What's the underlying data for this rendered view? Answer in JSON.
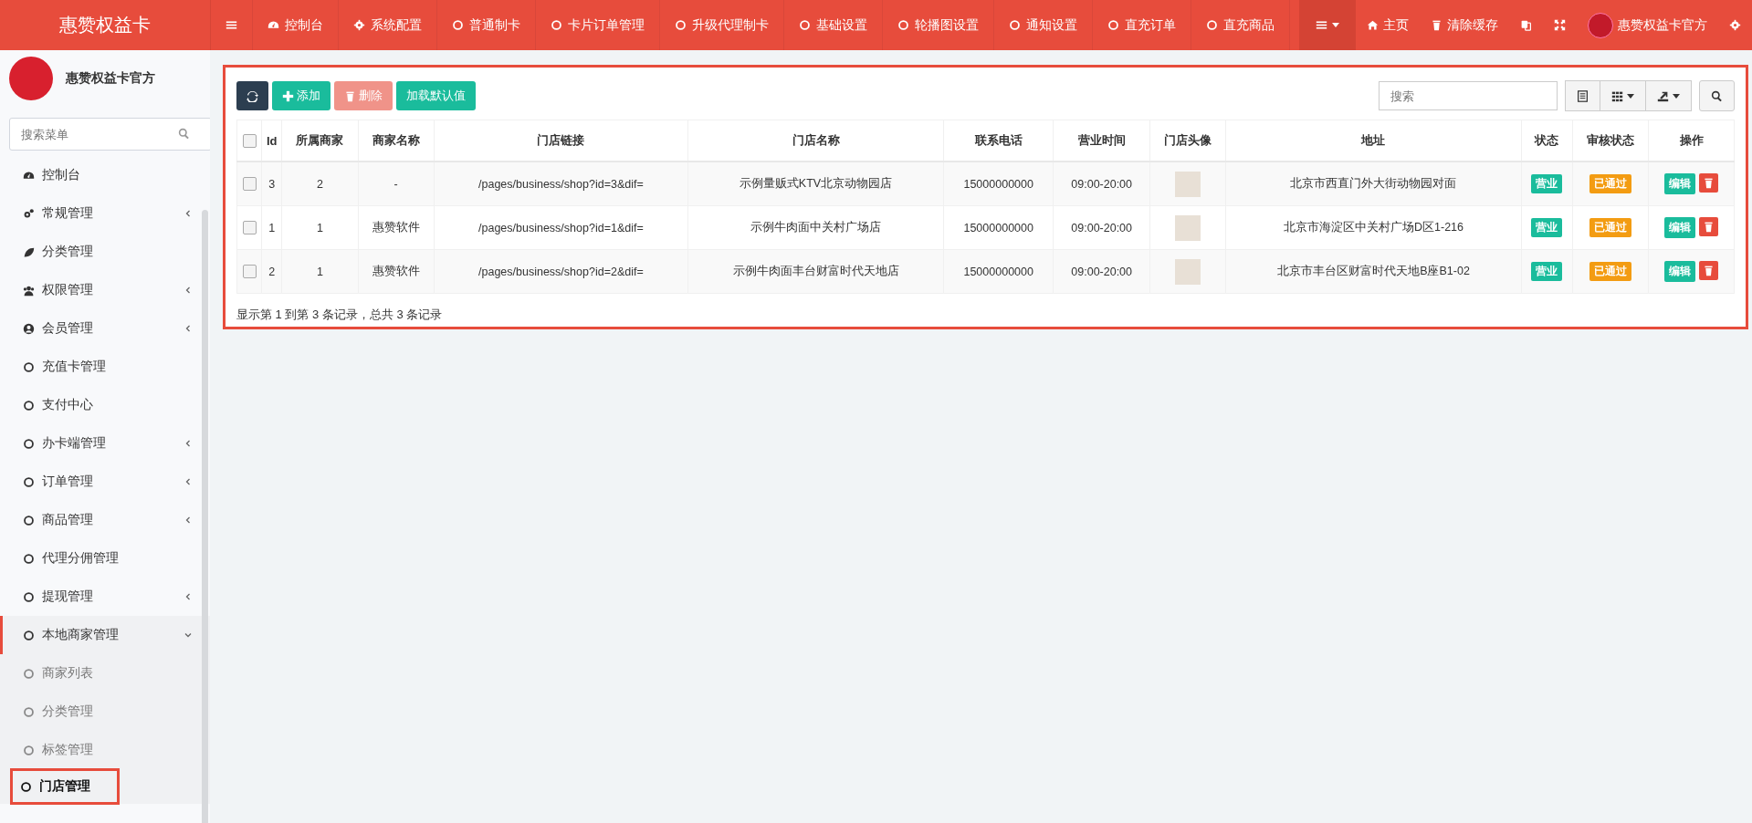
{
  "brand": {
    "title": "惠赞权益卡"
  },
  "top_nav": [
    {
      "label": "控制台",
      "kind": "dashboard"
    },
    {
      "label": "系统配置",
      "kind": "gear"
    },
    {
      "label": "普通制卡",
      "kind": "circle"
    },
    {
      "label": "卡片订单管理",
      "kind": "circle"
    },
    {
      "label": "升级代理制卡",
      "kind": "circle"
    },
    {
      "label": "基础设置",
      "kind": "circle"
    },
    {
      "label": "轮播图设置",
      "kind": "circle"
    },
    {
      "label": "通知设置",
      "kind": "circle"
    },
    {
      "label": "直充订单",
      "kind": "circle"
    },
    {
      "label": "直充商品",
      "kind": "circle"
    }
  ],
  "top_right": [
    {
      "kind": "menu"
    },
    {
      "kind": "home",
      "label": "主页"
    },
    {
      "kind": "trash",
      "label": "清除缓存"
    },
    {
      "kind": "translate"
    },
    {
      "kind": "fullscreen"
    },
    {
      "kind": "user",
      "label": "惠赞权益卡官方"
    },
    {
      "kind": "settings"
    }
  ],
  "sidebar": {
    "user": {
      "name": "惠赞权益卡官方"
    },
    "search": {
      "placeholder": "搜索菜单"
    },
    "items": [
      {
        "label": "控制台",
        "kind": "dashboard"
      },
      {
        "label": "常规管理",
        "kind": "cogs",
        "expanded": false
      },
      {
        "label": "分类管理",
        "kind": "leaf"
      },
      {
        "label": "权限管理",
        "kind": "users",
        "expanded": false
      },
      {
        "label": "会员管理",
        "kind": "user",
        "expanded": false
      },
      {
        "label": "充值卡管理",
        "kind": "circle"
      },
      {
        "label": "支付中心",
        "kind": "circle"
      },
      {
        "label": "办卡端管理",
        "kind": "circle",
        "expanded": false
      },
      {
        "label": "订单管理",
        "kind": "circle",
        "expanded": false
      },
      {
        "label": "商品管理",
        "kind": "circle",
        "expanded": false
      },
      {
        "label": "代理分佣管理",
        "kind": "circle"
      },
      {
        "label": "提现管理",
        "kind": "circle",
        "expanded": false
      },
      {
        "label": "本地商家管理",
        "kind": "circle",
        "expanded": true,
        "children": [
          {
            "label": "商家列表",
            "selected": false
          },
          {
            "label": "分类管理",
            "selected": false
          },
          {
            "label": "标签管理",
            "selected": false
          },
          {
            "label": "门店管理",
            "selected": true
          }
        ]
      }
    ]
  },
  "toolbar": {
    "buttons": [
      {
        "kind": "refresh"
      },
      {
        "kind": "add",
        "label": "添加"
      },
      {
        "kind": "delete",
        "label": "删除",
        "disabled": true
      },
      {
        "kind": "load",
        "label": "加载默认值"
      }
    ],
    "search": {
      "placeholder": "搜索"
    }
  },
  "table": {
    "all_checked": false,
    "columns": [
      "Id",
      "所属商家",
      "商家名称",
      "门店链接",
      "门店名称",
      "联系电话",
      "营业时间",
      "门店头像",
      "地址",
      "状态",
      "审核状态",
      "操作"
    ],
    "rows": [
      {
        "checked": false,
        "id": "3",
        "merchant_id": "2",
        "merchant_name": "-",
        "link": "/pages/business/shop?id=3&dif=",
        "name": "示例量贩式KTV北京动物园店",
        "phone": "15000000000",
        "hours": "09:00-20:00",
        "address": "北京市西直门外大街动物园对面",
        "status": "营业",
        "review": "已通过",
        "edit": "编辑"
      },
      {
        "checked": false,
        "id": "1",
        "merchant_id": "1",
        "merchant_name": "惠赞软件",
        "link": "/pages/business/shop?id=1&dif=",
        "name": "示例牛肉面中关村广场店",
        "phone": "15000000000",
        "hours": "09:00-20:00",
        "address": "北京市海淀区中关村广场D区1-216",
        "status": "营业",
        "review": "已通过",
        "edit": "编辑"
      },
      {
        "checked": false,
        "id": "2",
        "merchant_id": "1",
        "merchant_name": "惠赞软件",
        "link": "/pages/business/shop?id=2&dif=",
        "name": "示例牛肉面丰台财富时代天地店",
        "phone": "15000000000",
        "hours": "09:00-20:00",
        "address": "北京市丰台区财富时代天地B座B1-02",
        "status": "营业",
        "review": "已通过",
        "edit": "编辑"
      }
    ]
  },
  "pagination": {
    "summary": "显示第 1 到第 3 条记录，总共 3 条记录"
  }
}
